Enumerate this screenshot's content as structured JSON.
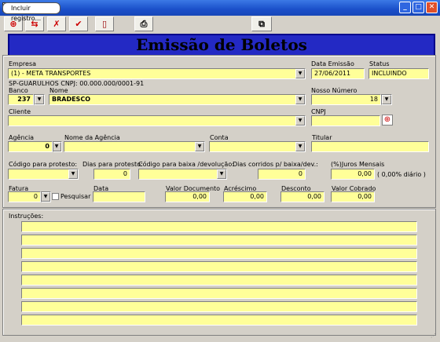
{
  "window": {
    "title": "",
    "tooltip": "Incluir registro..."
  },
  "titlebar_buttons": {
    "minimize": "_",
    "maximize": "□",
    "close": "✕"
  },
  "toolbar": {
    "new_label": "⊕",
    "edit_label": "⇆",
    "delete_label": "✗",
    "confirm_label": "✔",
    "exit_label": "▯",
    "print_label": "⎙",
    "copy_label": "⧉"
  },
  "header": {
    "title": "Emissão de Boletos"
  },
  "form": {
    "empresa": {
      "label": "Empresa",
      "value": "(1) - META TRANSPORTES",
      "info": "SP-GUARULHOS CNPJ: 00.000.000/0001-91"
    },
    "data_emissao": {
      "label": "Data Emissão",
      "value": "27/06/2011"
    },
    "status": {
      "label": "Status",
      "value": "INCLUINDO"
    },
    "banco": {
      "label": "Banco",
      "value": "237"
    },
    "nome": {
      "label": "Nome",
      "value": "BRADESCO"
    },
    "nosso_numero": {
      "label": "Nosso Número",
      "value": "18"
    },
    "cliente": {
      "label": "Cliente",
      "value": ""
    },
    "cnpj": {
      "label": "CNPJ",
      "value": ""
    },
    "agencia": {
      "label": "Agência",
      "value": "0"
    },
    "nome_agencia": {
      "label": "Nome da Agência",
      "value": ""
    },
    "conta": {
      "label": "Conta",
      "value": ""
    },
    "titular": {
      "label": "Titular",
      "value": ""
    },
    "cod_protesto": {
      "label": "Código para protesto:",
      "value": ""
    },
    "dias_protesto": {
      "label": "Dias para protesto:",
      "value": "0"
    },
    "cod_baixa": {
      "label": "Código para baixa /devolução:",
      "value": ""
    },
    "dias_baixa": {
      "label": "Dias corridos p/ baixa/dev.:",
      "value": "0"
    },
    "juros": {
      "label": "(%)Juros Mensais",
      "value": "0,00",
      "diario": "( 0,00% diário )"
    },
    "fatura": {
      "label": "Fatura",
      "value": "0",
      "pesquisar": "Pesquisar"
    },
    "data": {
      "label": "Data",
      "value": ""
    },
    "valor_documento": {
      "label": "Valor Documento",
      "value": "0,00"
    },
    "acrescimo": {
      "label": "Acréscimo",
      "value": "0,00"
    },
    "desconto": {
      "label": "Desconto",
      "value": "0,00"
    },
    "valor_cobrado": {
      "label": "Valor Cobrado",
      "value": "0,00"
    }
  },
  "instrucoes": {
    "label": "Instruções:",
    "lines": [
      "",
      "",
      "",
      "",
      "",
      "",
      "",
      ""
    ]
  },
  "colors": {
    "field": "#ffff99",
    "header": "#2329c4",
    "title": "#1a4fc9"
  }
}
